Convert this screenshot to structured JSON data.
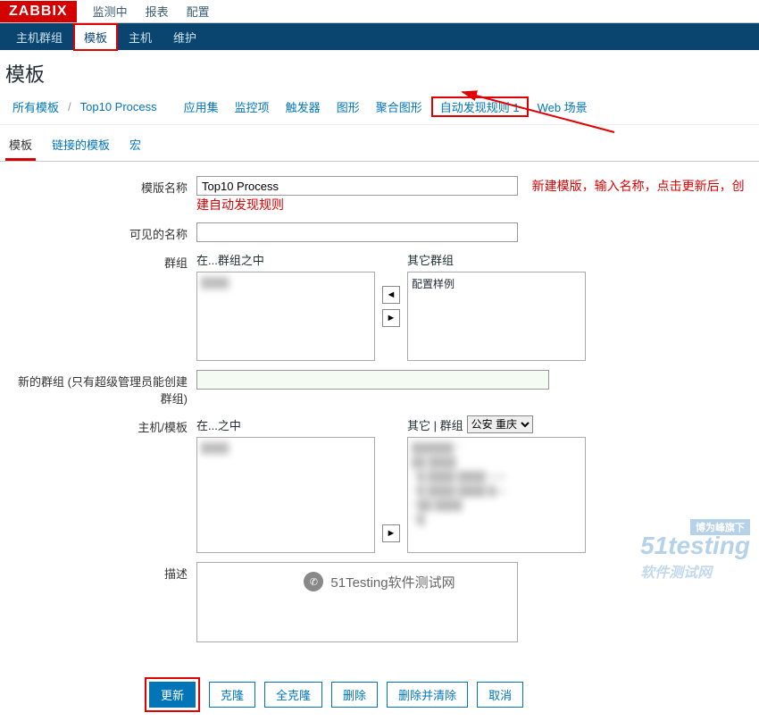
{
  "logo": "ZABBIX",
  "topnav": {
    "items": [
      "监测中",
      "报表",
      "配置"
    ]
  },
  "subnav": {
    "items": [
      "主机群组",
      "模板",
      "主机",
      "维护"
    ],
    "active": "模板"
  },
  "page_title": "模板",
  "filters": {
    "all": "所有模板",
    "current": "Top10 Process",
    "items": [
      "应用集",
      "监控项",
      "触发器",
      "图形",
      "聚合图形"
    ],
    "discovery": "自动发现规则 1",
    "web": "Web 场景"
  },
  "tabs": {
    "items": [
      "模板",
      "链接的模板",
      "宏"
    ],
    "active": "模板"
  },
  "form": {
    "template_name": {
      "label": "模版名称",
      "value": "Top10 Process"
    },
    "visible_name": {
      "label": "可见的名称",
      "value": ""
    },
    "groups": {
      "label": "群组",
      "in_label": "在...群组之中",
      "other_label": "其它群组",
      "other_items": [
        "配置样例"
      ]
    },
    "new_group": {
      "label": "新的群组 (只有超级管理员能创建群组)"
    },
    "hosts": {
      "label": "主机/模板",
      "in_label": "在...之中",
      "other_label": "其它 | 群组",
      "select_options": [
        "公安 重庆"
      ]
    },
    "description": {
      "label": "描述"
    }
  },
  "annotation": "新建模版，输入名称，点击更新后，创建自动发现规则",
  "buttons": {
    "update": "更新",
    "clone": "克隆",
    "full_clone": "全克隆",
    "delete": "删除",
    "delete_clear": "删除并清除",
    "cancel": "取消"
  },
  "watermark": {
    "tag": "博为峰旗下",
    "main": "51testing",
    "sub": "软件测试网"
  },
  "wechat": "51Testing软件测试网"
}
